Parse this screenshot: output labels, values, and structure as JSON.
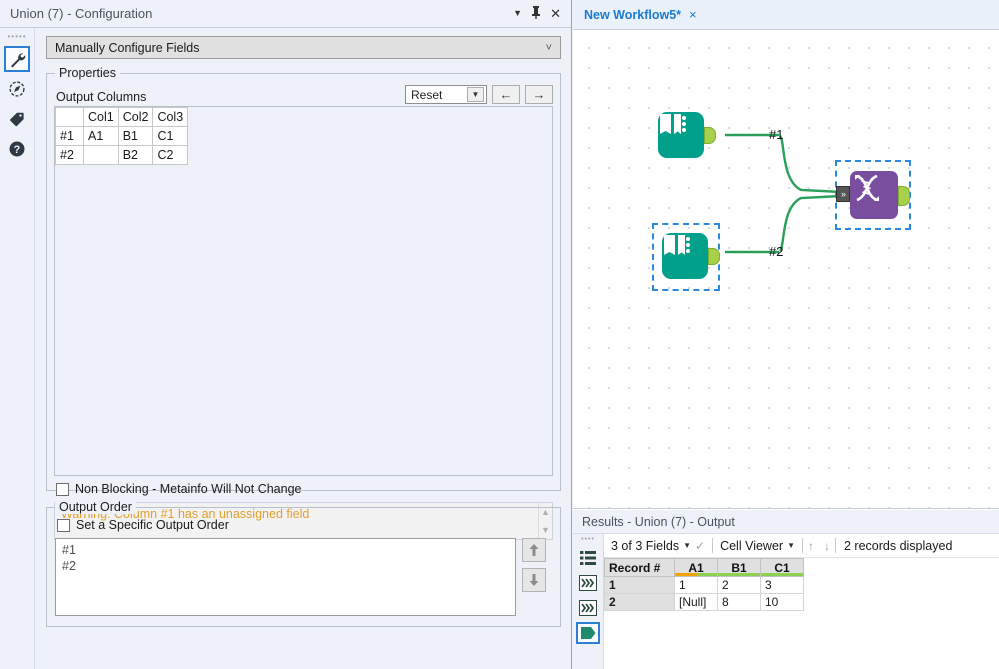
{
  "config_panel": {
    "title": "Union (7) - Configuration",
    "titlebar_icons": [
      "dropdown-caret",
      "pin",
      "close"
    ],
    "rail_icons": [
      "wrench-icon",
      "compass-icon",
      "tag-icon",
      "help-icon"
    ],
    "mode_select": {
      "value": "Manually Configure Fields"
    },
    "properties": {
      "legend": "Properties",
      "output_columns_label": "Output Columns",
      "reset_value": "Reset",
      "back_label": "←",
      "forward_label": "→",
      "table": {
        "corner": "",
        "headers": [
          "Col1",
          "Col2",
          "Col3"
        ],
        "rows": [
          {
            "label": "#1",
            "cells": [
              "A1",
              "B1",
              "C1"
            ]
          },
          {
            "label": "#2",
            "cells": [
              "",
              "B2",
              "C2"
            ]
          }
        ]
      },
      "non_blocking_label": "Non Blocking - Metainfo Will Not Change",
      "non_blocking_checked": false,
      "warning_text": "Warning: Column #1 has an unassigned field",
      "warning_color": "#e2a02c"
    },
    "output_order": {
      "legend": "Output Order",
      "checkbox_label": "Set a Specific Output Order",
      "checkbox_checked": false,
      "items": [
        "#1",
        "#2"
      ],
      "move_up_label": "↑",
      "move_down_label": "↓"
    }
  },
  "workflow": {
    "tab_label": "New Workflow5*",
    "tab_close": "×",
    "connection_labels": [
      "#1",
      "#2"
    ],
    "nodes": [
      {
        "name": "input-data-tool-1",
        "type": "input",
        "color": "#00a08a",
        "selected": false
      },
      {
        "name": "input-data-tool-2",
        "type": "input",
        "color": "#00a08a",
        "selected": true
      },
      {
        "name": "union-tool",
        "type": "union",
        "color": "#7a4e9f",
        "selected": true
      }
    ]
  },
  "results": {
    "title": "Results - Union (7) - Output",
    "rail_icons": [
      "list-icon",
      "chevrons-icon",
      "chevrons-icon",
      "output-tag-icon"
    ],
    "toolbar": {
      "fields_label": "3 of 3 Fields",
      "viewer_label": "Cell Viewer",
      "up_arrow": "↑",
      "down_arrow": "↓",
      "status": "2 records displayed"
    },
    "grid": {
      "record_header": "Record #",
      "columns": [
        {
          "name": "A1",
          "bar": "partial"
        },
        {
          "name": "B1",
          "bar": "full"
        },
        {
          "name": "C1",
          "bar": "full"
        }
      ],
      "rows": [
        {
          "num": "1",
          "cells": [
            "1",
            "2",
            "3"
          ]
        },
        {
          "num": "2",
          "cells": [
            "[Null]",
            "8",
            "10"
          ]
        }
      ]
    }
  }
}
